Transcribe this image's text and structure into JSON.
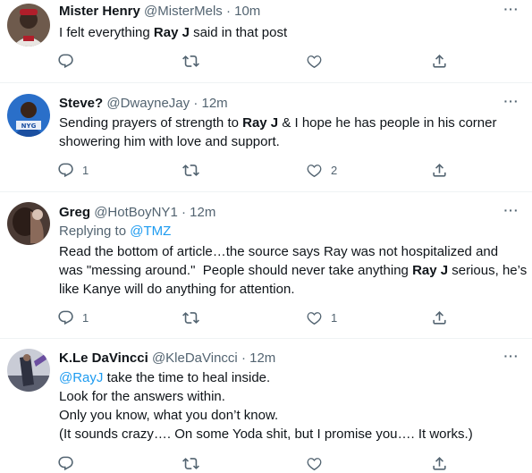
{
  "tweets": [
    {
      "name": "Mister Henry",
      "handle": "@MisterMels",
      "dot": "·",
      "time": "10m",
      "more": "···",
      "lines": [
        [
          {
            "t": "I felt everything "
          },
          {
            "t": "Ray J",
            "b": true
          },
          {
            "t": " said in that post"
          }
        ]
      ],
      "replies": "",
      "retweets": "",
      "likes": ""
    },
    {
      "name": "Steve?",
      "handle": "@DwayneJay",
      "dot": "·",
      "time": "12m",
      "more": "···",
      "lines": [
        [
          {
            "t": "Sending prayers of strength to "
          },
          {
            "t": "Ray J",
            "b": true
          },
          {
            "t": " & I hope he has people in his corner"
          }
        ],
        [
          {
            "t": "showering him with love and support."
          }
        ]
      ],
      "replies": "1",
      "retweets": "",
      "likes": "2"
    },
    {
      "name": "Greg",
      "handle": "@HotBoyNY1",
      "dot": "·",
      "time": "12m",
      "more": "···",
      "replying_label": "Replying to ",
      "replying_to": "@TMZ",
      "lines": [
        [
          {
            "t": "Read the bottom of article…the source says Ray was not hospitalized and"
          }
        ],
        [
          {
            "t": "was \"messing around.\"  People should never take anything "
          },
          {
            "t": "Ray J",
            "b": true
          },
          {
            "t": " serious, he’s"
          }
        ],
        [
          {
            "t": "like Kanye will do anything for attention."
          }
        ]
      ],
      "replies": "1",
      "retweets": "",
      "likes": "1"
    },
    {
      "name": "K.Le DaVincci",
      "handle": "@KleDaVincci",
      "dot": "·",
      "time": "12m",
      "more": "···",
      "lines": [
        [
          {
            "t": "@RayJ",
            "link": true
          },
          {
            "t": " take the time to heal inside."
          }
        ],
        [
          {
            "t": "Look for the answers within."
          }
        ],
        [
          {
            "t": "Only you know, what you don’t know."
          }
        ],
        [
          {
            "t": "(It sounds crazy…. On some Yoda shit, but I promise you…. It works.)"
          }
        ]
      ],
      "replies": "",
      "retweets": "",
      "likes": ""
    }
  ]
}
